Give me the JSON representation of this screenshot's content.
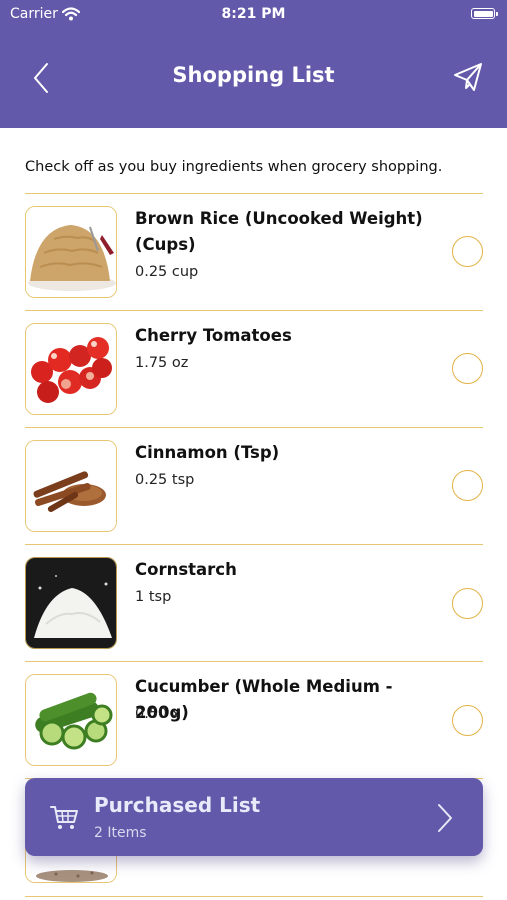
{
  "status": {
    "carrier": "Carrier",
    "time": "8:21 PM"
  },
  "header": {
    "title": "Shopping List"
  },
  "intro": "Check off as you buy ingredients when grocery shopping.",
  "items": [
    {
      "name": "Brown Rice (Uncooked Weight) (Cups)",
      "qty": "0.25 cup",
      "icon": "brown-rice-image",
      "checked": false
    },
    {
      "name": "Cherry Tomatoes",
      "qty": "1.75 oz",
      "icon": "cherry-tomatoes-image",
      "checked": false
    },
    {
      "name": "Cinnamon (Tsp)",
      "qty": "0.25 tsp",
      "icon": "cinnamon-image",
      "checked": false
    },
    {
      "name": "Cornstarch",
      "qty": "1 tsp",
      "icon": "cornstarch-image",
      "checked": false
    },
    {
      "name": "Cucumber (Whole Medium - 200g)",
      "qty": "0.50 x",
      "icon": "cucumber-image",
      "checked": false
    }
  ],
  "purchased": {
    "title": "Purchased List",
    "count": "2 Items"
  },
  "colors": {
    "primary": "#6259AA",
    "accent": "#E7C774",
    "check_border": "#E2B347"
  }
}
